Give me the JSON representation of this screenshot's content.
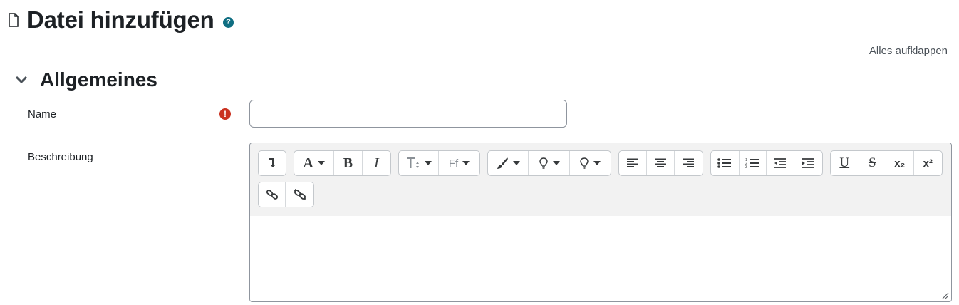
{
  "page": {
    "title": "Datei hinzufügen",
    "title_icon": "file-icon",
    "help_icon": "question-circle-icon",
    "help_symbol": "?",
    "expand_all": "Alles aufklappen"
  },
  "section": {
    "title": "Allgemeines",
    "toggle_icon": "chevron-down-icon"
  },
  "form": {
    "name_label": "Name",
    "name_value": "",
    "required_icon": "exclamation-circle-icon",
    "required_symbol": "!",
    "description_label": "Beschreibung"
  },
  "toolbar": {
    "groups": [
      {
        "buttons": [
          {
            "icon": "collapse-toolbar-icon"
          }
        ]
      },
      {
        "buttons": [
          {
            "icon": "font-style-icon",
            "label": "A",
            "dropdown": true
          },
          {
            "icon": "bold-icon",
            "label": "B"
          },
          {
            "icon": "italic-icon",
            "label": "I"
          }
        ]
      },
      {
        "buttons": [
          {
            "icon": "font-size-icon",
            "dropdown": true
          },
          {
            "icon": "font-family-icon",
            "label": "Ff",
            "dropdown": true
          }
        ]
      },
      {
        "buttons": [
          {
            "icon": "brush-icon",
            "dropdown": true
          },
          {
            "icon": "text-color-icon",
            "dropdown": true
          },
          {
            "icon": "background-color-icon",
            "dropdown": true
          }
        ]
      },
      {
        "buttons": [
          {
            "icon": "align-left-icon"
          },
          {
            "icon": "align-center-icon"
          },
          {
            "icon": "align-right-icon"
          }
        ]
      },
      {
        "buttons": [
          {
            "icon": "unordered-list-icon"
          },
          {
            "icon": "ordered-list-icon"
          },
          {
            "icon": "outdent-icon"
          },
          {
            "icon": "indent-icon"
          }
        ]
      },
      {
        "buttons": [
          {
            "icon": "underline-icon",
            "label": "U"
          },
          {
            "icon": "strikethrough-icon",
            "label": "S"
          },
          {
            "icon": "subscript-icon",
            "label": "x₂"
          },
          {
            "icon": "superscript-icon",
            "label": "x²"
          }
        ]
      },
      {
        "buttons": [
          {
            "icon": "link-icon"
          },
          {
            "icon": "unlink-icon"
          }
        ]
      }
    ]
  },
  "colors": {
    "text": "#1d2125",
    "help": "#0f6e82",
    "required": "#ca3120",
    "toolbar_bg": "#f2f2f2",
    "border": "#8f959e"
  }
}
